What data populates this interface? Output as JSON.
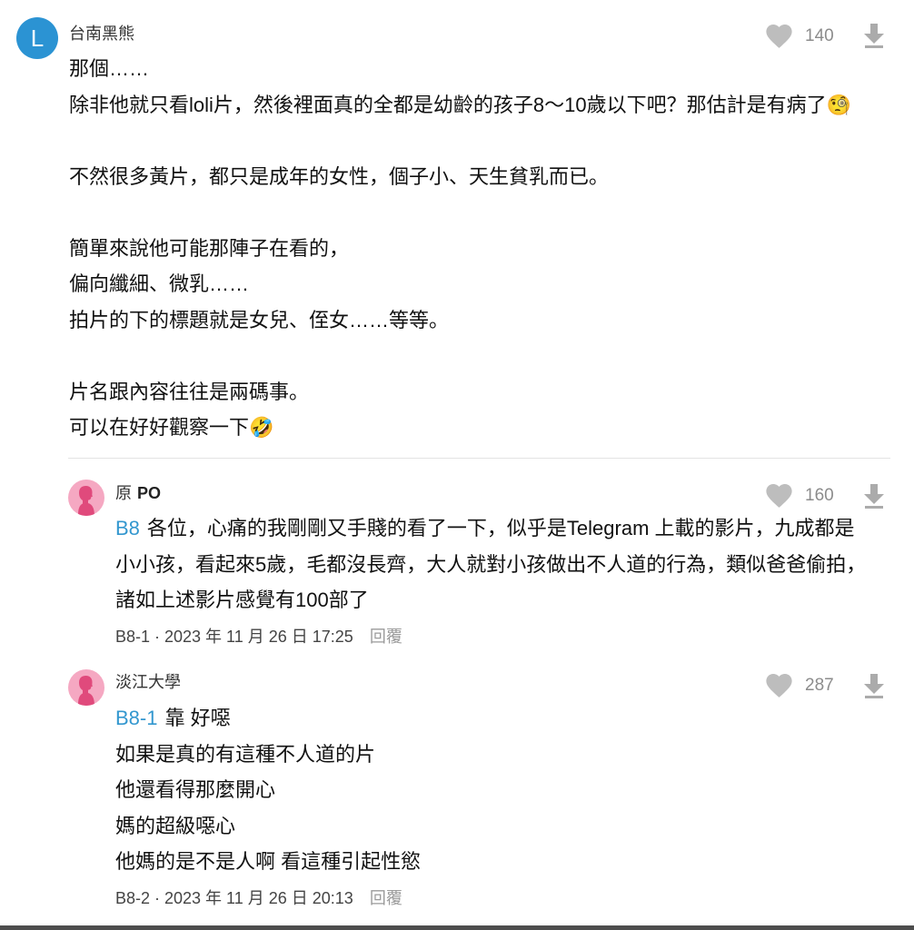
{
  "comment": {
    "avatar_letter": "L",
    "avatar_color": "#2b93d3",
    "author": "台南黑熊",
    "likes": "140",
    "paragraphs": [
      [
        "那個……",
        "除非他就只看loli片，然後裡面真的全都是幼齡的孩子8～10歲以下吧？那估計是有病了🧐"
      ],
      [
        "不然很多黃片，都只是成年的女性，個子小、天生貧乳而已。"
      ],
      [
        "簡單來說他可能那陣子在看的，",
        "偏向纖細、微乳……",
        "拍片的下的標題就是女兒、侄女……等等。"
      ],
      [
        "片名跟內容往往是兩碼事。",
        "可以在好好觀察一下🤣"
      ]
    ]
  },
  "replies": [
    {
      "author": "原",
      "author_badge": "PO",
      "likes": "160",
      "mention": "B8",
      "first_line": "各位，心痛的我剛剛又手賤的看了一下，似乎是Telegram 上載的影片，九成都是",
      "lines": [
        "小小孩，看起來5歲，毛都沒長齊，大人就對小孩做出不人道的行為，類似爸爸偷拍，",
        "諸如上述影片感覺有100部了"
      ],
      "meta": "B8-1 · 2023 年 11 月 26 日 17:25",
      "reply_label": "回覆"
    },
    {
      "author": "淡江大學",
      "likes": "287",
      "mention": "B8-1",
      "first_line": "靠 好噁",
      "lines": [
        "如果是真的有這種不人道的片",
        "他還看得那麼開心",
        "媽的超級噁心",
        "他媽的是不是人啊 看這種引起性慾"
      ],
      "meta": "B8-2 · 2023 年 11 月 26 日 20:13",
      "reply_label": "回覆"
    }
  ],
  "colors": {
    "mention": "#3397cf",
    "avatar_blue": "#2b93d3",
    "avatar_pink": "#f5a8c2",
    "avatar_silhouette": "#e04a7c",
    "icon_grey": "#bdbdbd"
  },
  "icons": {
    "like": "heart-icon",
    "dislike": "down-arrow-icon",
    "reply_avatar": "female-silhouette-icon"
  }
}
